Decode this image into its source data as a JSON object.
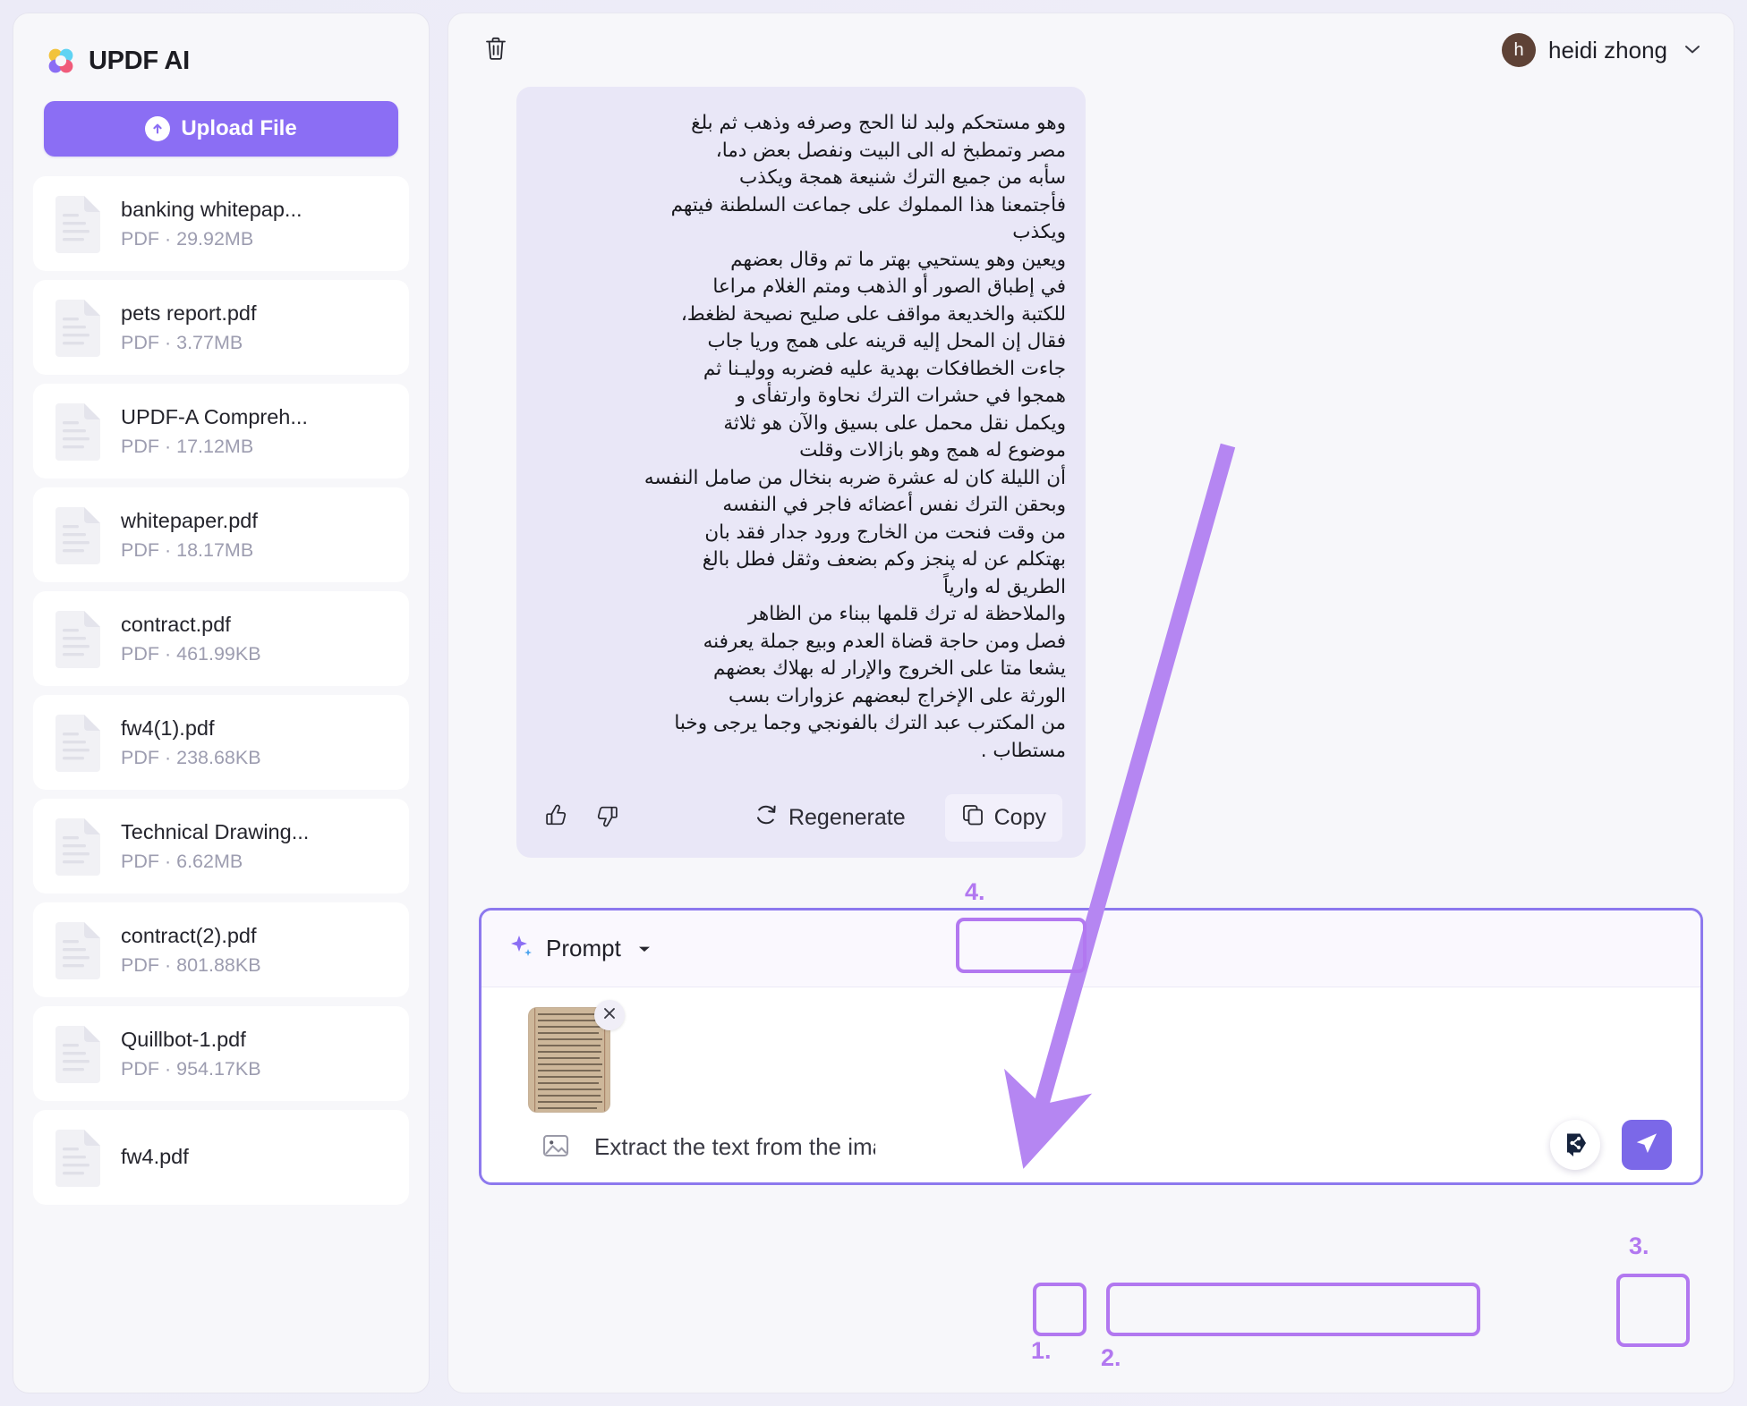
{
  "app": {
    "brand_title": "UPDF AI",
    "brand_logo_icon": "updf-flower-logo-icon"
  },
  "sidebar": {
    "upload_button": {
      "label": "Upload File",
      "icon": "upload-arrow-icon"
    },
    "files": [
      {
        "name": "banking whitepap...",
        "meta": "PDF · 29.92MB"
      },
      {
        "name": "pets report.pdf",
        "meta": "PDF · 3.77MB"
      },
      {
        "name": "UPDF-A Compreh...",
        "meta": "PDF · 17.12MB"
      },
      {
        "name": "whitepaper.pdf",
        "meta": "PDF · 18.17MB"
      },
      {
        "name": "contract.pdf",
        "meta": "PDF · 461.99KB"
      },
      {
        "name": "fw4(1).pdf",
        "meta": "PDF · 238.68KB"
      },
      {
        "name": "Technical Drawing...",
        "meta": "PDF · 6.62MB"
      },
      {
        "name": "contract(2).pdf",
        "meta": "PDF · 801.88KB"
      },
      {
        "name": "Quillbot-1.pdf",
        "meta": "PDF · 954.17KB"
      },
      {
        "name": "fw4.pdf",
        "meta": ""
      }
    ]
  },
  "topbar": {
    "trash_icon": "trash-icon",
    "user": {
      "avatar_initial": "h",
      "name": "heidi zhong",
      "caret": "⌄"
    }
  },
  "message": {
    "body": "وهو مستحكم ولبد لنا الحج وصرفه وذهب ثم بلغ\nمصر وتمطبخ له الى البيت ونفصل بعض دما،\nسأبه من جميع الترك شنيعة همجة ويكذب\nفأجتمعنا هذا المملوك على جماعت السلطنة فيتهم\nويكذب\nويعين وهو يستحيي بهتر ما تم وقال بعضهم\nفي إطباق الصور أو الذهب ومتم الغلام مراعا\nللكتبة والخديعة مواقف على صليح نصيحة لظغط،\nفقال إن المحل إليه قرينه على همج وريا جاب\nجاءت الخطافكات بهدية عليه فضربه ووليـنا ثم\nهمجوا في حشرات الترك نحاوة وارتفأى و\nويكمل نقل محمل على بسيق والآن هو ثلاثة\nموضوع له همج وهو بازالات وقلت\nأن الليلة كان له عشرة ضربه بنخال من صامل النفسه\nوبحقن الترك نفس أعضائه فاجر في النفسه\nمن وقت فنحت من الخارج ورود جدار فقد بان\nبهتكلم عن له پنجز وكم بضعف وثقل فطل بالغ\nالطريق له وارياً\nوالملاحظة له ترك قلمها ببناء من الظاهر\nفصل ومن حاجة قضاة العدم وبيع جملة يعرفنه\nيشعا متا على الخروج والإرار له بهلاك بعضهم\nالورثة على الإخراج لبعضهم عزوارات بسب\nمن المكترب عبد الترك بالفونجي وجما يرجى وخبا\nمستطاب ."
  },
  "message_actions": {
    "thumb_up_icon": "thumbs-up-icon",
    "thumb_down_icon": "thumbs-down-icon",
    "regenerate": {
      "label": "Regenerate",
      "icon": "refresh-icon"
    },
    "copy": {
      "label": "Copy",
      "icon": "copy-icon"
    }
  },
  "composer": {
    "mode_label": "Prompt",
    "mode_icon": "sparkle-icon",
    "mode_caret": "▾",
    "attachment": {
      "remove_icon": "close-icon",
      "thumbnail_alt": "manuscript-page-thumbnail"
    },
    "image_button_icon": "image-icon",
    "input_value": "Extract the text from the image",
    "input_placeholder": "Extract the text from the image",
    "chat_fab_icon": "share-node-icon",
    "send_button_icon": "send-icon"
  },
  "annotations": {
    "steps": [
      {
        "id": "1",
        "label": "1."
      },
      {
        "id": "2",
        "label": "2."
      },
      {
        "id": "3",
        "label": "3."
      },
      {
        "id": "4",
        "label": "4."
      }
    ],
    "arrow": {
      "color": "#b586f2",
      "from": "copy-button",
      "to": "prompt-composer"
    }
  },
  "colors": {
    "accent_purple": "#8b6ef4",
    "highlight_purple": "#b278f0",
    "bubble_bg": "#e9e7f7",
    "page_bg": "#eceaf6"
  }
}
